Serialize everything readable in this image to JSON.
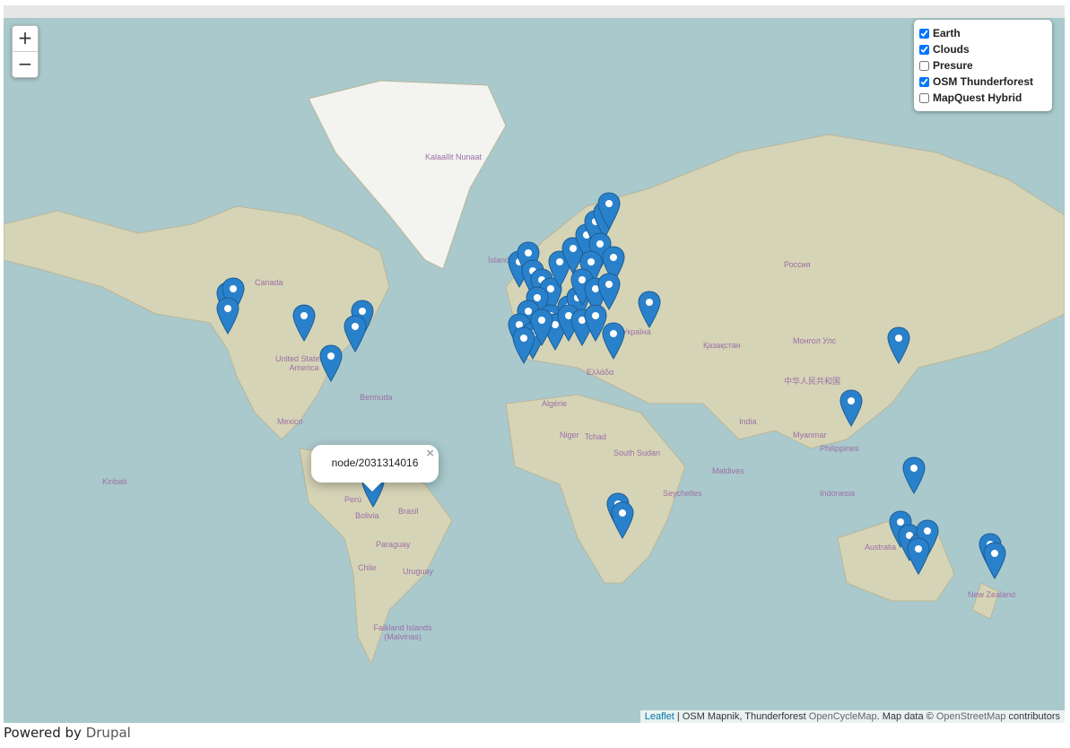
{
  "zoom": {
    "in_label": "+",
    "out_label": "−"
  },
  "layer_control": {
    "layers": [
      {
        "label": "Earth",
        "checked": true
      },
      {
        "label": "Clouds",
        "checked": true
      },
      {
        "label": "Presure",
        "checked": false
      },
      {
        "label": "OSM Thunderforest",
        "checked": true
      },
      {
        "label": "MapQuest Hybrid",
        "checked": false
      }
    ]
  },
  "popup": {
    "text": "node/2031314016",
    "close": "×"
  },
  "attribution": {
    "leaflet": "Leaflet",
    "sep": " | ",
    "text1": "OSM Mapnik, Thunderforest ",
    "ocm": "OpenCycleMap",
    "text2": ". Map data © ",
    "osm": "OpenStreetMap",
    "text3": " contributors"
  },
  "footer": {
    "prefix": "Powered by ",
    "link": "Drupal"
  },
  "map_labels": [
    {
      "id": "greenland",
      "text": "Kalaallit Nunaat"
    },
    {
      "id": "canada",
      "text": "Canada"
    },
    {
      "id": "usa",
      "text": "United States of America"
    },
    {
      "id": "mexico",
      "text": "Mexico"
    },
    {
      "id": "bermuda",
      "text": "Bermuda"
    },
    {
      "id": "russia",
      "text": "Россия"
    },
    {
      "id": "kazakhstan",
      "text": "Қазақстан"
    },
    {
      "id": "mongolia",
      "text": "Монгол Улс"
    },
    {
      "id": "china",
      "text": "中华人民共和国"
    },
    {
      "id": "india",
      "text": "India"
    },
    {
      "id": "brasil",
      "text": "Brasil"
    },
    {
      "id": "peru",
      "text": "Perú"
    },
    {
      "id": "bolivia",
      "text": "Bolivia"
    },
    {
      "id": "paraguay",
      "text": "Paraguay"
    },
    {
      "id": "chile",
      "text": "Chile"
    },
    {
      "id": "uruguay",
      "text": "Uruguay"
    },
    {
      "id": "algerie",
      "text": "Algérie"
    },
    {
      "id": "niger",
      "text": "Niger"
    },
    {
      "id": "tchad",
      "text": "Tchad"
    },
    {
      "id": "southsudan",
      "text": "South Sudan"
    },
    {
      "id": "australia",
      "text": "Australia"
    },
    {
      "id": "nz",
      "text": "New Zealand"
    },
    {
      "id": "philippines",
      "text": "Philippines"
    },
    {
      "id": "indonesia",
      "text": "Indonesia"
    },
    {
      "id": "falkland",
      "text": "Falkland Islands (Malvinas)"
    },
    {
      "id": "iceland",
      "text": "Ísland"
    },
    {
      "id": "ellada",
      "text": "Ελλάδα"
    },
    {
      "id": "ukraina",
      "text": "Україна"
    },
    {
      "id": "myanmar",
      "text": "Myanmar"
    },
    {
      "id": "kiribati",
      "text": "Kiribati"
    },
    {
      "id": "seychelles",
      "text": "Seychelles"
    },
    {
      "id": "maldives",
      "text": "Maldives"
    }
  ],
  "colors": {
    "marker": "#2a81cb",
    "ocean": "#a9c9cc",
    "land": "#d8d6b8"
  }
}
